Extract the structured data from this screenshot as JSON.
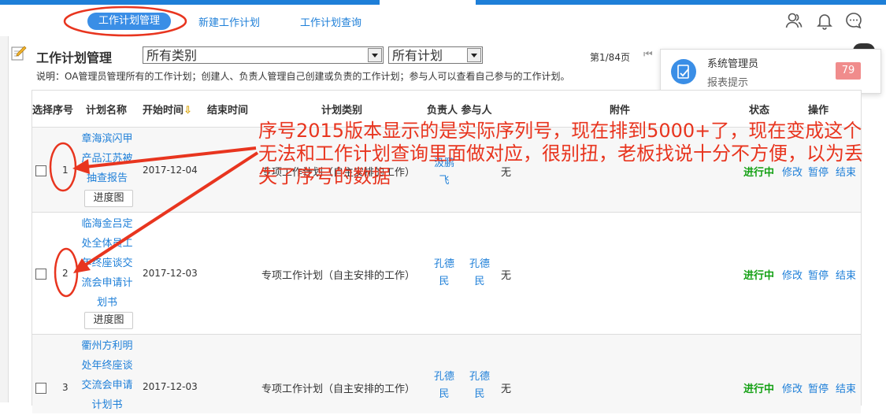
{
  "nav": {
    "tabs": [
      "工作计划管理",
      "新建工作计划",
      "工作计划查询"
    ],
    "icons": [
      "user-icon",
      "bell-icon",
      "chat-icon"
    ]
  },
  "page": {
    "title": "工作计划管理",
    "category_select": "所有类别",
    "plan_select": "所有计划",
    "page_info": "第1/84页",
    "description": "说明：OA管理员管理所有的工作计划；创建人、负责人管理自己创建或负责的工作计划；参与人可以查看自己参与的工作计划。"
  },
  "notification": {
    "name": "系统管理员",
    "subtitle": "报表提示",
    "count": "79"
  },
  "table": {
    "headers": {
      "select_seq": "选择序号",
      "name": "计划名称",
      "start": "开始时间",
      "end": "结束时间",
      "category": "计划类别",
      "owner_participant": "负责人 参与人",
      "attachment": "附件",
      "status": "状态",
      "ops": "操作"
    },
    "rows": [
      {
        "seq": "1",
        "name_lines": [
          "章海滨闪甲",
          "产品江苏被",
          "抽查报告"
        ],
        "start": "2017-12-04",
        "category": "专项工作计划（自主安排的工作）",
        "owner": [
          "汲鹏",
          "飞"
        ],
        "attachment": "无",
        "status": "进行中",
        "ops": [
          "修改",
          "暂停",
          "结束"
        ],
        "progress_button": "进度图"
      },
      {
        "seq": "2",
        "name_lines": [
          "临海金吕定",
          "处全体员工",
          "年终座谈交",
          "流会申请计",
          "划书"
        ],
        "start": "2017-12-03",
        "category": "专项工作计划（自主安排的工作）",
        "owner": [
          "孔德",
          "民"
        ],
        "participant": [
          "孔德",
          "民"
        ],
        "attachment": "无",
        "status": "进行中",
        "ops": [
          "修改",
          "暂停",
          "结束"
        ],
        "progress_button": "进度图"
      },
      {
        "seq": "3",
        "name_lines": [
          "衢州方利明",
          "处年终座谈",
          "交流会申请",
          "计划书"
        ],
        "start": "2017-12-03",
        "category": "专项工作计划（自主安排的工作）",
        "owner": [
          "孔德",
          "民"
        ],
        "participant": [
          "孔德",
          "民"
        ],
        "attachment": "无",
        "status": "进行中",
        "ops": [
          "修改",
          "暂停",
          "结束"
        ]
      }
    ]
  },
  "annotation": {
    "text": "序号2015版本显示的是实际序列号，现在排到5000+了，现在变成这个无法和工作计划查询里面做对应，很别扭，老板找说十分不方便，以为丢失了序号的数据",
    "color": "#e8351f"
  }
}
